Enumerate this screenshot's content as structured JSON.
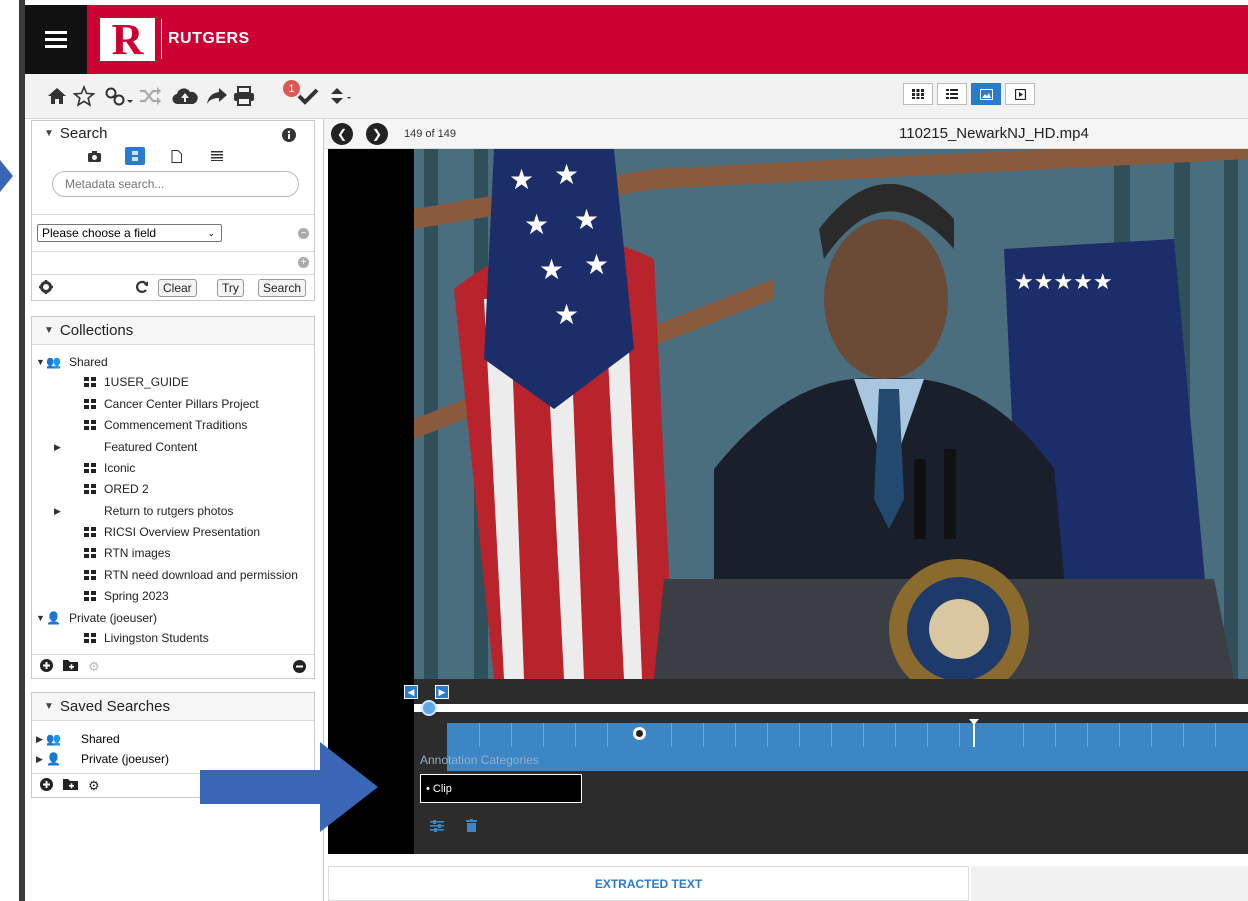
{
  "header": {
    "logo_letter": "R",
    "brand": "RUTGERS"
  },
  "toolbar": {
    "badge_count": "1",
    "icons": [
      "home-icon",
      "star-icon",
      "link-icon",
      "shuffle-icon",
      "cloud-upload-icon",
      "share-icon",
      "print-icon",
      "check-icon",
      "sort-icon"
    ]
  },
  "view_modes": [
    "grid-view",
    "list-view",
    "image-view",
    "video-view"
  ],
  "search": {
    "title": "Search",
    "placeholder": "Metadata search...",
    "field_select": "Please choose a field",
    "clear": "Clear",
    "try": "Try",
    "search": "Search"
  },
  "collections": {
    "title": "Collections",
    "shared": "Shared",
    "items": [
      "1USER_GUIDE",
      "Cancer Center Pillars Project",
      "Commencement Traditions",
      "Featured Content",
      "Iconic",
      "ORED 2",
      "Return to rutgers photos",
      "RICSI Overview Presentation",
      "RTN images",
      "RTN need download and permission",
      "Spring 2023"
    ],
    "private": "Private (joeuser)",
    "private_items": [
      "Livingston Students"
    ]
  },
  "saved_searches": {
    "title": "Saved Searches",
    "shared": "Shared",
    "private": "Private (joeuser)"
  },
  "viewer": {
    "counter": "149 of 149",
    "filename": "110215_NewarkNJ_HD.mp4",
    "annotation_categories": "Annotation Categories",
    "clip_label": "• Clip",
    "extracted_text": "EXTRACTED TEXT"
  },
  "colors": {
    "brand_red": "#cc0033",
    "accent_blue": "#2a7ad0",
    "timeline_blue": "#3d86c6",
    "callout_arrow": "#3a66b8"
  }
}
